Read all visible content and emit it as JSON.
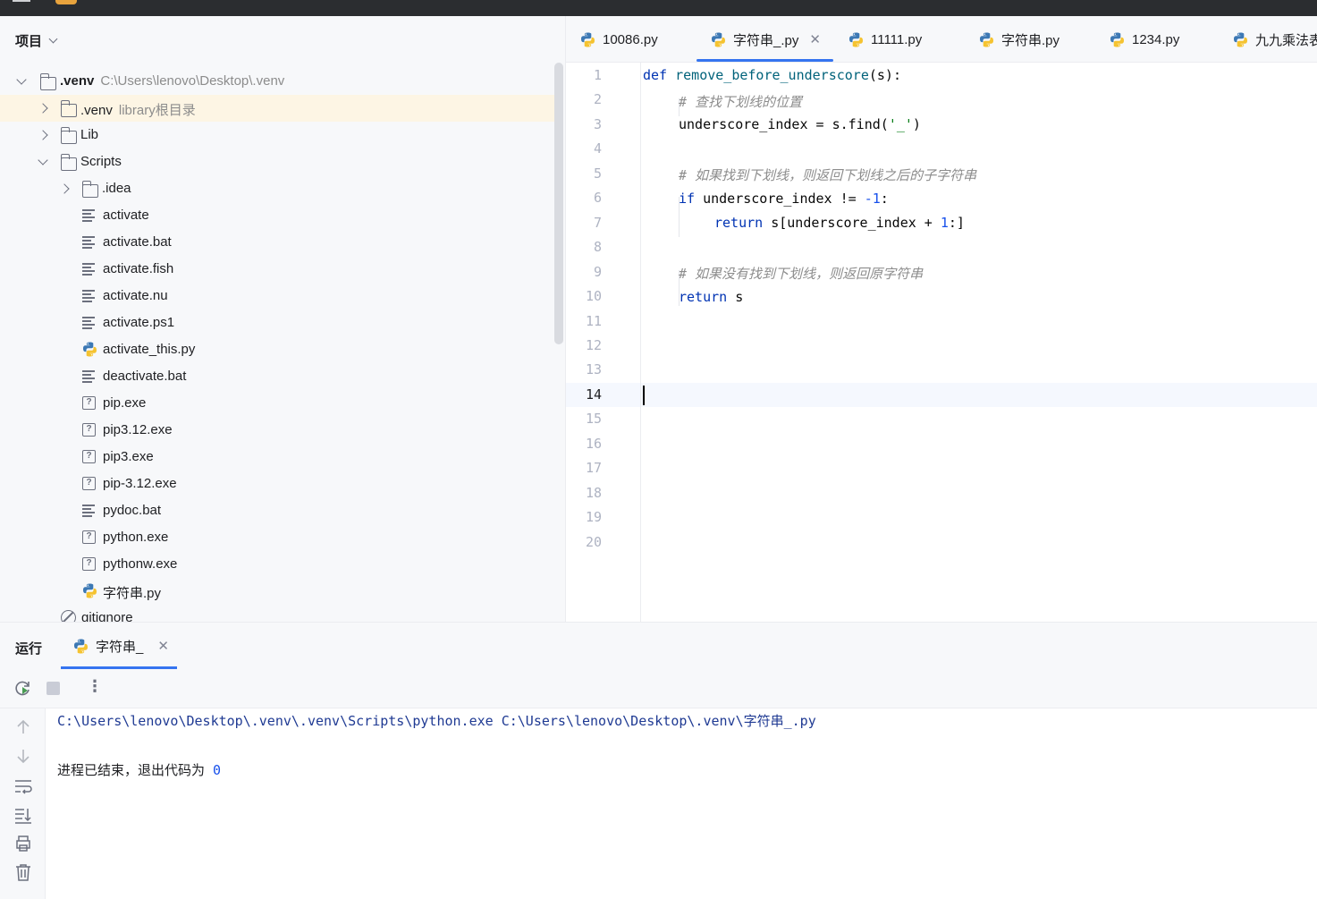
{
  "project_panel": {
    "title": "项目",
    "tree": [
      {
        "name": ".venv",
        "hint": "C:\\Users\\lenovo\\Desktop\\.venv",
        "type": "folder",
        "depth": 0,
        "expanded": true,
        "bold": true
      },
      {
        "name": ".venv",
        "hint": "library根目录",
        "type": "folder",
        "depth": 1,
        "expanded": false,
        "selected": true
      },
      {
        "name": "Lib",
        "type": "folder",
        "depth": 1,
        "expanded": false
      },
      {
        "name": "Scripts",
        "type": "folder",
        "depth": 1,
        "expanded": true
      },
      {
        "name": ".idea",
        "type": "folder",
        "depth": 2,
        "expanded": false
      },
      {
        "name": "activate",
        "type": "text",
        "depth": 2
      },
      {
        "name": "activate.bat",
        "type": "text",
        "depth": 2
      },
      {
        "name": "activate.fish",
        "type": "text",
        "depth": 2
      },
      {
        "name": "activate.nu",
        "type": "text",
        "depth": 2
      },
      {
        "name": "activate.ps1",
        "type": "text",
        "depth": 2
      },
      {
        "name": "activate_this.py",
        "type": "python",
        "depth": 2
      },
      {
        "name": "deactivate.bat",
        "type": "text",
        "depth": 2
      },
      {
        "name": "pip.exe",
        "type": "unknown",
        "depth": 2
      },
      {
        "name": "pip3.12.exe",
        "type": "unknown",
        "depth": 2
      },
      {
        "name": "pip3.exe",
        "type": "unknown",
        "depth": 2
      },
      {
        "name": "pip-3.12.exe",
        "type": "unknown",
        "depth": 2
      },
      {
        "name": "pydoc.bat",
        "type": "text",
        "depth": 2
      },
      {
        "name": "python.exe",
        "type": "unknown",
        "depth": 2
      },
      {
        "name": "pythonw.exe",
        "type": "unknown",
        "depth": 2
      },
      {
        "name": "字符串.py",
        "type": "python",
        "depth": 2
      },
      {
        "name": "gitignore",
        "type": "ignored",
        "depth": 1
      }
    ]
  },
  "editor_tabs": [
    {
      "label": "10086.py",
      "active": false
    },
    {
      "label": "字符串_.py",
      "active": true,
      "closable": true
    },
    {
      "label": "11111.py",
      "active": false
    },
    {
      "label": "字符串.py",
      "active": false
    },
    {
      "label": "1234.py",
      "active": false
    },
    {
      "label": "九九乘法表",
      "active": false
    }
  ],
  "editor": {
    "line_numbers": [
      "1",
      "2",
      "3",
      "4",
      "5",
      "6",
      "7",
      "8",
      "9",
      "10",
      "11",
      "12",
      "13",
      "14",
      "15",
      "16",
      "17",
      "18",
      "19",
      "20"
    ],
    "current_line": 14,
    "code": {
      "l1_kw": "def",
      "l1_fn": "remove_before_underscore",
      "l1_rest": "(s):",
      "l2_cm": "# 查找下划线的位置",
      "l3_a": "underscore_index = s.find(",
      "l3_str": "'_'",
      "l3_b": ")",
      "l5_cm": "# 如果找到下划线，则返回下划线之后的子字符串",
      "l6_kw": "if",
      "l6_a": " underscore_index != ",
      "l6_num": "-1",
      "l6_b": ":",
      "l7_kw": "return",
      "l7_a": " s[underscore_index + ",
      "l7_num": "1",
      "l7_b": ":]",
      "l9_cm": "# 如果没有找到下划线，则返回原字符串",
      "l10_kw": "return",
      "l10_a": " s"
    }
  },
  "run_panel": {
    "title": "运行",
    "tab_label": "字符串_",
    "toolbar": {
      "rerun": "rerun-icon",
      "stop": "stop-icon",
      "more": "⋮"
    },
    "output": {
      "command": "C:\\Users\\lenovo\\Desktop\\.venv\\.venv\\Scripts\\python.exe C:\\Users\\lenovo\\Desktop\\.venv\\字符串_.py",
      "exit_text": "进程已结束，退出代码为 ",
      "exit_code": "0"
    }
  },
  "colors": {
    "accent": "#3574f0",
    "keyword": "#0033b3",
    "function": "#00627a",
    "string": "#067d17",
    "number": "#1750eb",
    "comment": "#8c8c8c"
  }
}
